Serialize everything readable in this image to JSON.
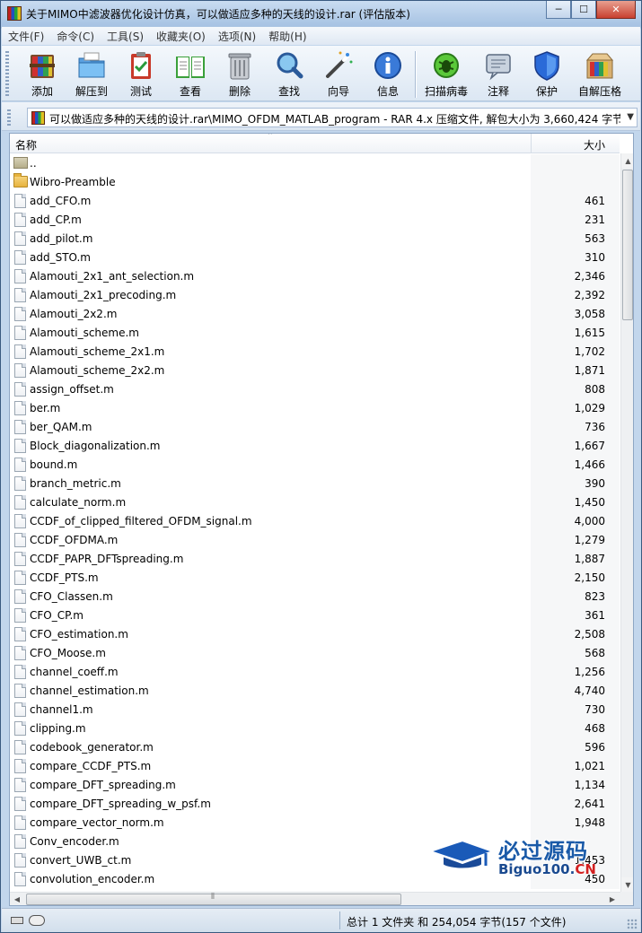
{
  "window": {
    "title": "关于MIMO中滤波器优化设计仿真，可以做适应多种的天线的设计.rar (评估版本)",
    "min_glyph": "─",
    "max_glyph": "☐",
    "close_glyph": "✕"
  },
  "menu": [
    "文件(F)",
    "命令(C)",
    "工具(S)",
    "收藏夹(O)",
    "选项(N)",
    "帮助(H)"
  ],
  "toolbar": {
    "buttons": [
      "添加",
      "解压到",
      "测试",
      "查看",
      "删除",
      "查找",
      "向导",
      "信息",
      "扫描病毒",
      "注释",
      "保护",
      "自解压格"
    ]
  },
  "address": {
    "path": "可以做适应多种的天线的设计.rar\\MIMO_OFDM_MATLAB_program - RAR 4.x 压缩文件, 解包大小为 3,660,424 字节",
    "dropdown_glyph": "▼"
  },
  "list": {
    "col_name": "名称",
    "col_size": "大小",
    "sort_glyph": "⌃",
    "rows": [
      {
        "name": "..",
        "size": "",
        "kind": "up"
      },
      {
        "name": "Wibro-Preamble",
        "size": "",
        "kind": "folder"
      },
      {
        "name": "add_CFO.m",
        "size": "461",
        "kind": "file"
      },
      {
        "name": "add_CP.m",
        "size": "231",
        "kind": "file"
      },
      {
        "name": "add_pilot.m",
        "size": "563",
        "kind": "file"
      },
      {
        "name": "add_STO.m",
        "size": "310",
        "kind": "file"
      },
      {
        "name": "Alamouti_2x1_ant_selection.m",
        "size": "2,346",
        "kind": "file"
      },
      {
        "name": "Alamouti_2x1_precoding.m",
        "size": "2,392",
        "kind": "file"
      },
      {
        "name": "Alamouti_2x2.m",
        "size": "3,058",
        "kind": "file"
      },
      {
        "name": "Alamouti_scheme.m",
        "size": "1,615",
        "kind": "file"
      },
      {
        "name": "Alamouti_scheme_2x1.m",
        "size": "1,702",
        "kind": "file"
      },
      {
        "name": "Alamouti_scheme_2x2.m",
        "size": "1,871",
        "kind": "file"
      },
      {
        "name": "assign_offset.m",
        "size": "808",
        "kind": "file"
      },
      {
        "name": "ber.m",
        "size": "1,029",
        "kind": "file"
      },
      {
        "name": "ber_QAM.m",
        "size": "736",
        "kind": "file"
      },
      {
        "name": "Block_diagonalization.m",
        "size": "1,667",
        "kind": "file"
      },
      {
        "name": "bound.m",
        "size": "1,466",
        "kind": "file"
      },
      {
        "name": "branch_metric.m",
        "size": "390",
        "kind": "file"
      },
      {
        "name": "calculate_norm.m",
        "size": "1,450",
        "kind": "file"
      },
      {
        "name": "CCDF_of_clipped_filtered_OFDM_signal.m",
        "size": "4,000",
        "kind": "file"
      },
      {
        "name": "CCDF_OFDMA.m",
        "size": "1,279",
        "kind": "file"
      },
      {
        "name": "CCDF_PAPR_DFTspreading.m",
        "size": "1,887",
        "kind": "file"
      },
      {
        "name": "CCDF_PTS.m",
        "size": "2,150",
        "kind": "file"
      },
      {
        "name": "CFO_Classen.m",
        "size": "823",
        "kind": "file"
      },
      {
        "name": "CFO_CP.m",
        "size": "361",
        "kind": "file"
      },
      {
        "name": "CFO_estimation.m",
        "size": "2,508",
        "kind": "file"
      },
      {
        "name": "CFO_Moose.m",
        "size": "568",
        "kind": "file"
      },
      {
        "name": "channel_coeff.m",
        "size": "1,256",
        "kind": "file"
      },
      {
        "name": "channel_estimation.m",
        "size": "4,740",
        "kind": "file"
      },
      {
        "name": "channel1.m",
        "size": "730",
        "kind": "file"
      },
      {
        "name": "clipping.m",
        "size": "468",
        "kind": "file"
      },
      {
        "name": "codebook_generator.m",
        "size": "596",
        "kind": "file"
      },
      {
        "name": "compare_CCDF_PTS.m",
        "size": "1,021",
        "kind": "file"
      },
      {
        "name": "compare_DFT_spreading.m",
        "size": "1,134",
        "kind": "file"
      },
      {
        "name": "compare_DFT_spreading_w_psf.m",
        "size": "2,641",
        "kind": "file"
      },
      {
        "name": "compare_vector_norm.m",
        "size": "1,948",
        "kind": "file"
      },
      {
        "name": "Conv_encoder.m",
        "size": "",
        "kind": "file"
      },
      {
        "name": "convert_UWB_ct.m",
        "size": "1,453",
        "kind": "file"
      },
      {
        "name": "convolution_encoder.m",
        "size": "450",
        "kind": "file"
      }
    ]
  },
  "scroll": {
    "up_glyph": "▲",
    "down_glyph": "▼",
    "left_glyph": "◀",
    "right_glyph": "▶",
    "grip_glyph": "⦀"
  },
  "status": {
    "summary": "总计 1 文件夹 和 254,054 字节(157 个文件)"
  },
  "watermark": {
    "title": "必过源码",
    "sub_main": "Biguo100.",
    "sub_accent": "CN"
  }
}
